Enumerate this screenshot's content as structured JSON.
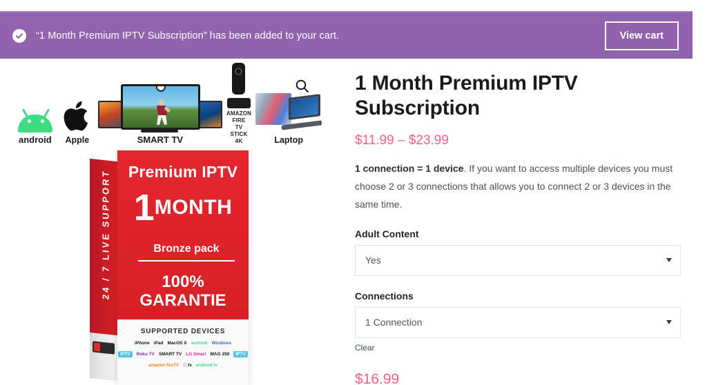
{
  "notification": {
    "icon": "check-circle-icon",
    "message": "“1 Month Premium IPTV Subscription” has been added to your cart.",
    "button_label": "View cart",
    "background_color": "#9263ad"
  },
  "gallery": {
    "zoom_icon": "magnifier-icon",
    "devices": [
      {
        "icon": "android-robot-icon",
        "label": "android"
      },
      {
        "icon": "apple-logo-icon",
        "label": "Apple"
      },
      {
        "icon": "smart-tv-icon",
        "label": "SMART TV"
      },
      {
        "icon": "amazon-fire-tv-stick-icon",
        "label": "AMAZON FIRE\nTV STICK 4K"
      },
      {
        "icon": "laptop-icon",
        "label": "Laptop"
      }
    ],
    "product_box": {
      "spine_text": "24 / 7  LIVE  SUPPORT",
      "brand": "Premium IPTV",
      "duration_number": "1",
      "duration_unit": "MONTH",
      "pack": "Bronze pack",
      "guarantee": "100%\nGARANTIE",
      "supported_heading": "SUPPORTED DEVICES",
      "supported_devices_rows": [
        [
          "iPhone",
          "iPad",
          "MacOS X",
          "android",
          "Windows"
        ],
        [
          "IPTV",
          "Roku TV",
          "SMART TV",
          "LG Smart",
          "MAG 250",
          "IPTV"
        ],
        [
          "amazon fireTV",
          " tv",
          "android tv"
        ]
      ]
    }
  },
  "product": {
    "title": "1 Month Premium IPTV Subscription",
    "price_range": "$11.99 – $23.99",
    "description_bold": "1 connection = 1 device",
    "description_rest": ". If you want to access multiple devices you must choose 2 or 3 connections that allows you to connect 2 or 3 devices in the same time.",
    "price_color": "#fb5d8b",
    "options": [
      {
        "label": "Adult Content",
        "value": "Yes",
        "name": "adult-content"
      },
      {
        "label": "Connections",
        "value": "1 Connection",
        "name": "connections"
      }
    ],
    "clear_label": "Clear",
    "selected_price": "$16.99"
  }
}
